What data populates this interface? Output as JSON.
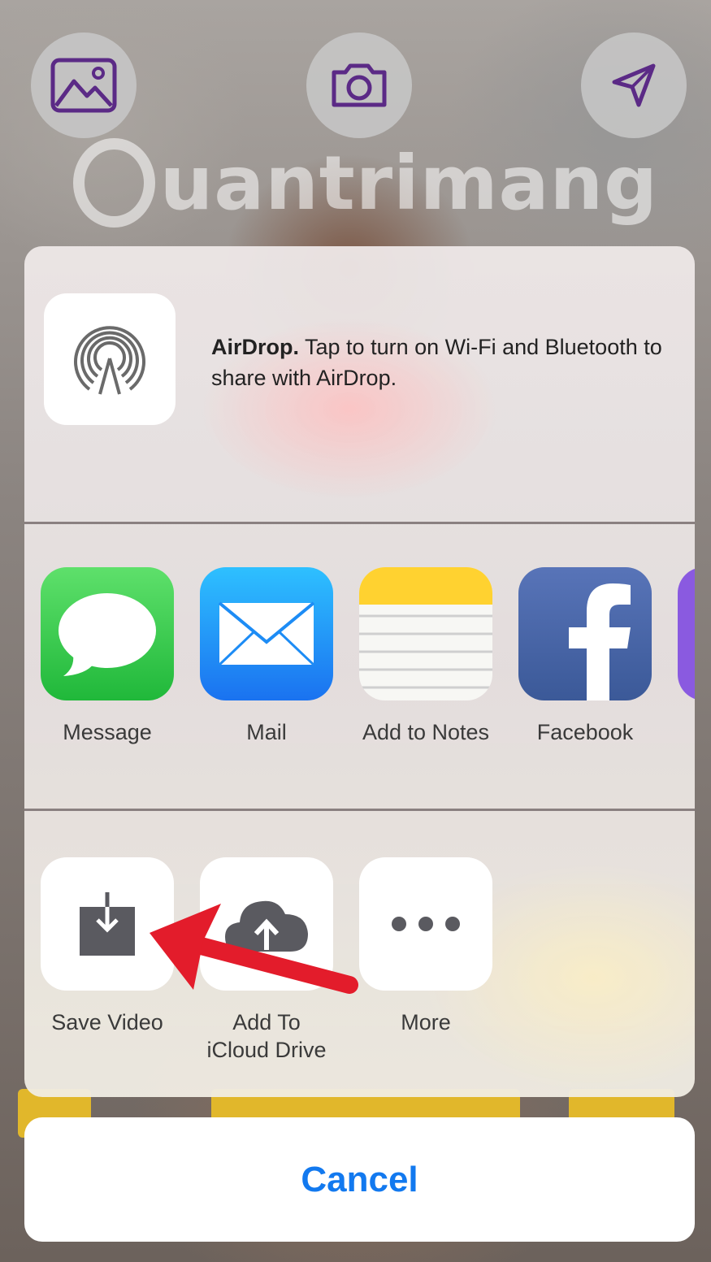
{
  "watermark": "uantrimang",
  "airdrop": {
    "title": "AirDrop.",
    "description": "Tap to turn on Wi-Fi and Bluetooth to share with AirDrop."
  },
  "apps": [
    {
      "label": "Message",
      "icon": "message-icon",
      "color": "#3ac94b"
    },
    {
      "label": "Mail",
      "icon": "mail-icon",
      "color": "#1d8cf5"
    },
    {
      "label": "Add to Notes",
      "icon": "notes-icon",
      "color": "#ffd230"
    },
    {
      "label": "Facebook",
      "icon": "facebook-icon",
      "color": "#3b5998"
    }
  ],
  "actions": [
    {
      "label": "Save Video",
      "icon": "save-video-icon"
    },
    {
      "label": "Add To iCloud Drive",
      "icon": "icloud-upload-icon"
    },
    {
      "label": "More",
      "icon": "more-icon"
    }
  ],
  "cancel_label": "Cancel",
  "colors": {
    "accent": "#1279ef",
    "annotation_arrow": "#e31c2b",
    "top_icon": "#5b2a86"
  }
}
